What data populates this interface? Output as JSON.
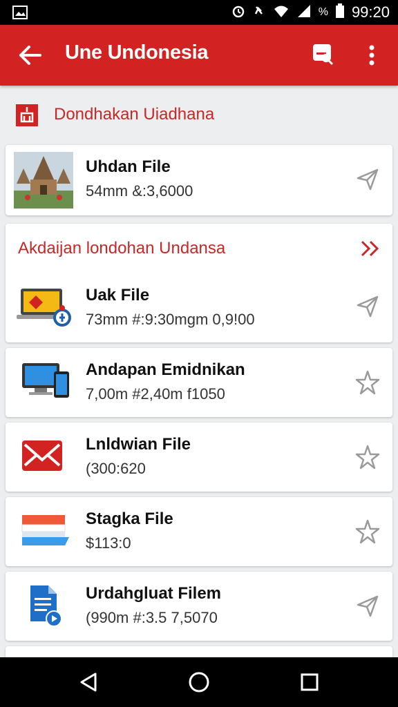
{
  "status": {
    "time": "99:20",
    "battery_label": "%"
  },
  "app_bar": {
    "title": "Une Undonesia"
  },
  "header": {
    "title": "Dondhakan Uiadhana"
  },
  "featured": {
    "title": "Uhdan File",
    "meta": "54mm &:3,6000"
  },
  "section": {
    "title": "Akdaijan londohan Undansa"
  },
  "items": [
    {
      "title": "Uak File",
      "meta": "73mm #:9:30mgm 0,9!00",
      "icon": "laptop-icon",
      "star": "send-icon"
    },
    {
      "title": "Andapan Emidnikan",
      "meta": "7,00m #2,40m f1050",
      "icon": "devices-icon",
      "star": "star-icon"
    },
    {
      "title": "Lnldwian File",
      "meta": "(300:620",
      "icon": "mail-icon",
      "star": "star-icon"
    },
    {
      "title": "Stagka File",
      "meta": "$113:0",
      "icon": "card-icon",
      "star": "star-icon"
    },
    {
      "title": "Urdahgluat Filem",
      "meta": "(990m #:3.5 7,5070",
      "icon": "document-icon",
      "star": "send-icon"
    }
  ],
  "colors": {
    "primary": "#d32222",
    "accent": "#c62828",
    "background": "#eceef0"
  }
}
